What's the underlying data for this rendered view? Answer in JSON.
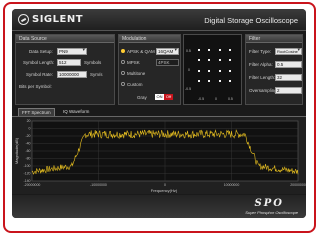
{
  "header": {
    "brand": "SIGLENT",
    "title": "Digital Storage Oscilloscope"
  },
  "data_source": {
    "title": "Data Source",
    "data_setup_label": "Data Setup:",
    "data_setup_value": "PN9",
    "symbol_length_label": "Symbol Length:",
    "symbol_length_value": "512",
    "symbol_length_unit": "Symbols",
    "symbol_rate_label": "Symbol Rate:",
    "symbol_rate_value": "10000000",
    "symbol_rate_unit": "Sym/s",
    "bits_per_symbol_label": "Bits per Symbol:"
  },
  "modulation": {
    "title": "Modulation",
    "option_apsk_qam": "APSK & QAM",
    "apsk_qam_value": "16QAM",
    "option_mpsk": "MPSK",
    "mpsk_value": "4PSK",
    "option_multitone": "Multitone",
    "option_custom": "Custom",
    "gray_label": "Gray",
    "gray_on": "ON",
    "gray_off": "Off"
  },
  "constellation": {
    "axis_labels": [
      "0.5",
      "0",
      "-0.5",
      "-0.5",
      "0",
      "0.5"
    ]
  },
  "filter": {
    "title": "Filter",
    "filter_type_label": "Filter Type:",
    "filter_type_value": "RootCosine",
    "filter_alpha_label": "Filter Alpha:",
    "filter_alpha_value": "0.5",
    "filter_length_label": "Filter Length:",
    "filter_length_value": "32",
    "oversampling_label": "Oversampling:",
    "oversampling_value": "2"
  },
  "tabs": [
    {
      "label": "FFT Spectrum"
    },
    {
      "label": "IQ Waveform"
    }
  ],
  "chart_data": {
    "type": "line",
    "title": "",
    "xlabel": "Frequency(Hz)",
    "ylabel": "Magnitude(dB)",
    "x_tick_labels": [
      "-20000000",
      "-10000000",
      "0",
      "10000000",
      "20000000"
    ],
    "y_tick_labels": [
      "20",
      "0",
      "-20",
      "-40",
      "-60",
      "-80",
      "-100",
      "-120",
      "-140"
    ],
    "xlim": [
      -20000000,
      20000000
    ],
    "ylim": [
      -140,
      20
    ],
    "grid": true,
    "series": [
      {
        "color": "#e8c020",
        "shape": "noisy plateau between -12.5 MHz and 12.5 MHz, rising from about -115 dB edges to about -10 dB top"
      }
    ]
  },
  "footer": {
    "logo": "SPO",
    "tagline": "Super Phosphor Oscilloscope"
  },
  "colors": {
    "accent": "#c9141c",
    "trace": "#e8c020"
  }
}
